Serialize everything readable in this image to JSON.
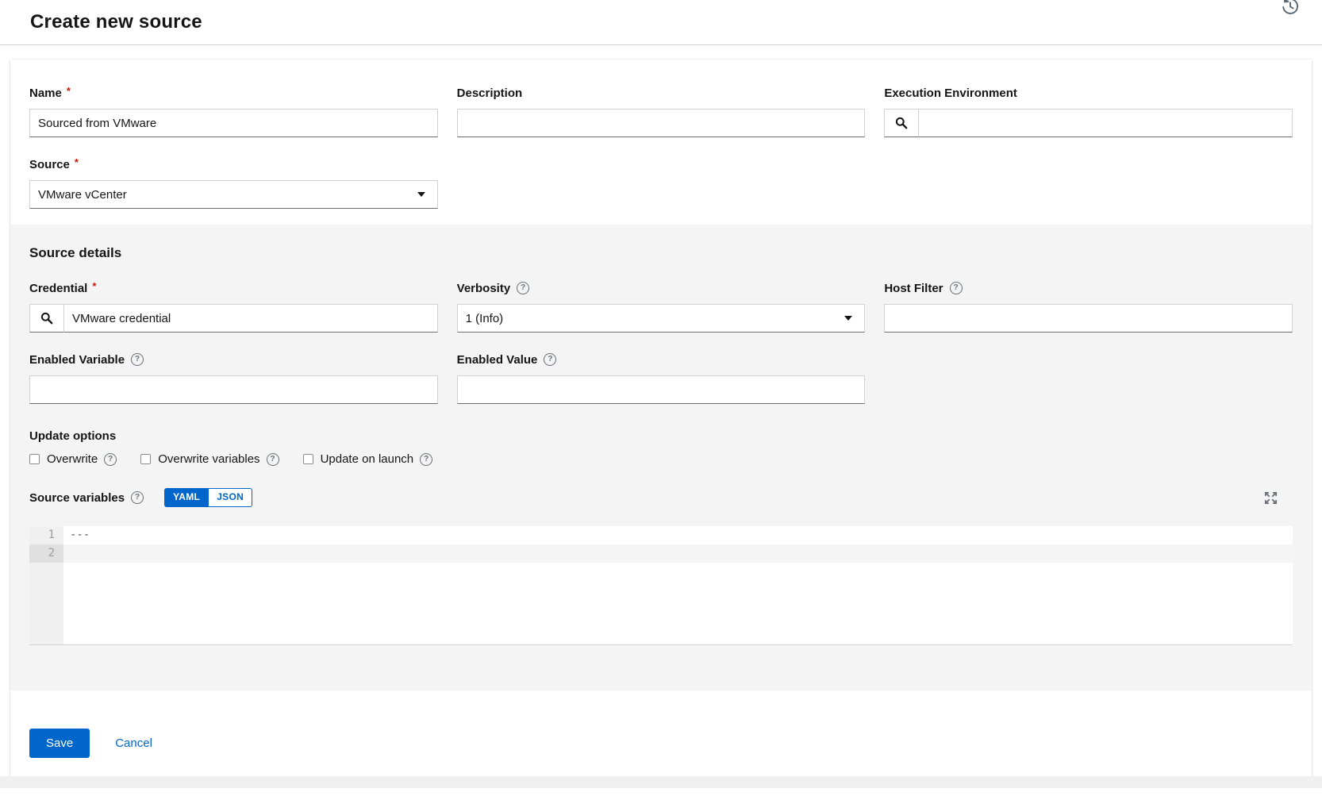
{
  "page": {
    "title": "Create new source"
  },
  "symbols": {
    "required_marker": "*",
    "help_marker": "?"
  },
  "form": {
    "name": {
      "label": "Name",
      "value": "Sourced from VMware",
      "required": true
    },
    "description": {
      "label": "Description",
      "value": ""
    },
    "execution_environment": {
      "label": "Execution Environment",
      "value": ""
    },
    "source": {
      "label": "Source",
      "value": "VMware vCenter",
      "required": true
    }
  },
  "source_details": {
    "heading": "Source details",
    "credential": {
      "label": "Credential",
      "value": "VMware credential",
      "required": true
    },
    "verbosity": {
      "label": "Verbosity",
      "value": "1 (Info)"
    },
    "host_filter": {
      "label": "Host Filter",
      "value": ""
    },
    "enabled_variable": {
      "label": "Enabled Variable",
      "value": ""
    },
    "enabled_value": {
      "label": "Enabled Value",
      "value": ""
    },
    "update_options": {
      "heading": "Update options",
      "checkboxes": [
        {
          "label": "Overwrite",
          "checked": false
        },
        {
          "label": "Overwrite variables",
          "checked": false
        },
        {
          "label": "Update on launch",
          "checked": false
        }
      ]
    },
    "source_variables": {
      "label": "Source variables",
      "modes": {
        "yaml": "YAML",
        "json": "JSON",
        "selected": "YAML"
      },
      "editor_lines": [
        {
          "number": "1",
          "content": "---"
        },
        {
          "number": "2",
          "content": ""
        }
      ]
    }
  },
  "actions": {
    "save_label": "Save",
    "cancel_label": "Cancel"
  },
  "colors": {
    "primary": "#0066cc",
    "required_asterisk": "#c9190b",
    "section_background": "#f4f4f4",
    "page_background": "#f0f0f0"
  }
}
